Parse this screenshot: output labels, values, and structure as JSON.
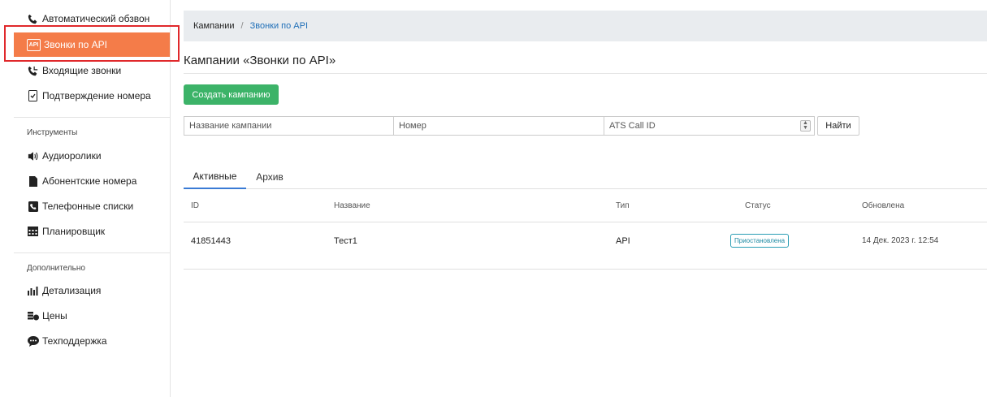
{
  "sidebar": {
    "items": [
      {
        "label": "Автоматический обзвон",
        "icon": "phone-icon"
      },
      {
        "label": "Звонки по API",
        "icon": "api-icon",
        "active": true
      },
      {
        "label": "Входящие звонки",
        "icon": "phone-incoming-icon"
      },
      {
        "label": "Подтверждение номера",
        "icon": "phone-check-icon"
      }
    ],
    "tools_title": "Инструменты",
    "tools": [
      {
        "label": "Аудиоролики",
        "icon": "speaker-icon"
      },
      {
        "label": "Абонентские номера",
        "icon": "sim-card-icon"
      },
      {
        "label": "Телефонные списки",
        "icon": "phone-book-icon"
      },
      {
        "label": "Планировщик",
        "icon": "calendar-icon"
      }
    ],
    "extra_title": "Дополнительно",
    "extra": [
      {
        "label": "Детализация",
        "icon": "chart-icon"
      },
      {
        "label": "Цены",
        "icon": "coins-icon"
      },
      {
        "label": "Техподдержка",
        "icon": "chat-icon"
      }
    ]
  },
  "breadcrumb": {
    "home": "Кампании",
    "separator": "/",
    "current": "Звонки по API"
  },
  "page_title": "Кампании «Звонки по API»",
  "create_button": "Создать кампанию",
  "filters": {
    "name_placeholder": "Название кампании",
    "number_placeholder": "Номер",
    "ats_placeholder": "ATS Call ID",
    "find_button": "Найти"
  },
  "tabs": [
    "Активные",
    "Архив"
  ],
  "table": {
    "headers": {
      "id": "ID",
      "name": "Название",
      "type": "Тип",
      "status": "Статус",
      "updated": "Обновлена"
    },
    "rows": [
      {
        "id": "41851443",
        "name": "Тест1",
        "type": "API",
        "status": "Приостановлена",
        "updated": "14 Дек. 2023 г. 12:54"
      }
    ]
  },
  "colors": {
    "accent": "#f47c49",
    "success": "#3cb368",
    "link": "#1f6fb8",
    "highlight": "#e0282b",
    "status": "#1e8aa3"
  }
}
